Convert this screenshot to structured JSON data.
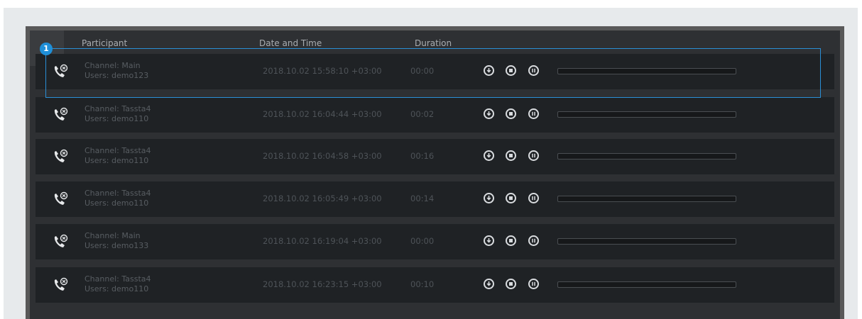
{
  "callout_number": "1",
  "columns": {
    "participant": "Participant",
    "datetime": "Date and Time",
    "duration": "Duration"
  },
  "rows": [
    {
      "channel": "Channel: Main",
      "users": "Users: demo123",
      "datetime": "2018.10.02 15:58:10 +03:00",
      "duration": "00:00"
    },
    {
      "channel": "Channel: Tassta4",
      "users": "Users: demo110",
      "datetime": "2018.10.02 16:04:44 +03:00",
      "duration": "00:02"
    },
    {
      "channel": "Channel: Tassta4",
      "users": "Users: demo110",
      "datetime": "2018.10.02 16:04:58 +03:00",
      "duration": "00:16"
    },
    {
      "channel": "Channel: Tassta4",
      "users": "Users: demo110",
      "datetime": "2018.10.02 16:05:49 +03:00",
      "duration": "00:14"
    },
    {
      "channel": "Channel: Main",
      "users": "Users: demo133",
      "datetime": "2018.10.02 16:19:04 +03:00",
      "duration": "00:00"
    },
    {
      "channel": "Channel: Tassta4",
      "users": "Users: demo110",
      "datetime": "2018.10.02 16:23:15 +03:00",
      "duration": "00:10"
    }
  ],
  "row_controls": [
    "download-icon",
    "stop-icon",
    "pause-icon"
  ],
  "row_icon": "phone-call-icon",
  "progress_values": [
    0,
    0,
    0,
    0,
    0,
    0
  ],
  "colors": {
    "accent": "#2a8fd6",
    "row_bg": "#1f2225",
    "panel_bg": "#2e3033",
    "text_dim": "#585d62"
  }
}
